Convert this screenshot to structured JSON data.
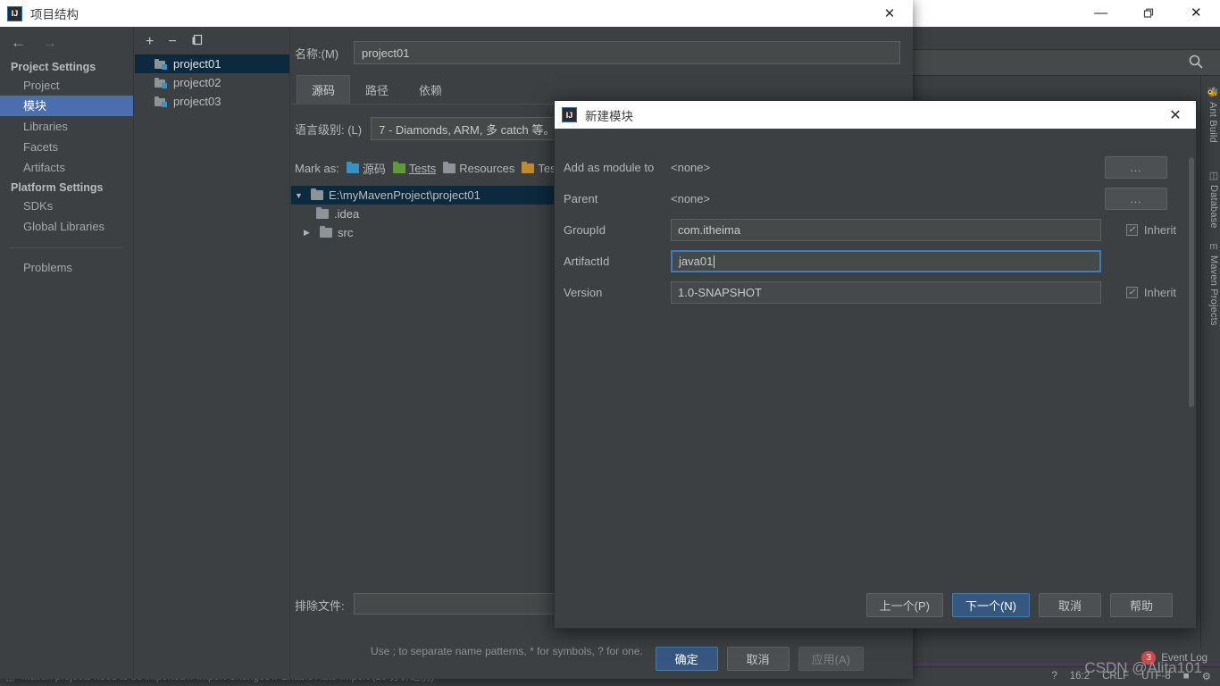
{
  "ide": {
    "window_controls": {
      "minimize": "—",
      "maximize": "❐",
      "close": "✕"
    },
    "search_icon": "search-icon",
    "right_toolwindows": [
      {
        "label": "Ant Build",
        "icon": "ant-icon"
      },
      {
        "label": "Database",
        "icon": "database-icon"
      },
      {
        "label": "Maven Projects",
        "icon": "maven-icon"
      }
    ],
    "statusbar": {
      "message": "Maven projects need to be imported // Import Changes // Enable Auto-Import (10 分钟之前)",
      "event_log": "Event Log",
      "event_count": "3",
      "caret": "16:2",
      "line_separator": "CRLF",
      "encoding": "UTF-8",
      "help": "?"
    },
    "watermark": "CSDN @Alita101"
  },
  "project_structure": {
    "title": "项目结构",
    "close_label": "✕",
    "nav": {
      "back": "←",
      "forward": "→",
      "groups": [
        {
          "label": "Project Settings",
          "items": [
            {
              "label": "Project",
              "selected": false
            },
            {
              "label": "模块",
              "selected": true
            },
            {
              "label": "Libraries",
              "selected": false
            },
            {
              "label": "Facets",
              "selected": false
            },
            {
              "label": "Artifacts",
              "selected": false
            }
          ]
        },
        {
          "label": "Platform Settings",
          "items": [
            {
              "label": "SDKs",
              "selected": false
            },
            {
              "label": "Global Libraries",
              "selected": false
            }
          ]
        }
      ],
      "extra": [
        {
          "label": "Problems"
        }
      ]
    },
    "modules_toolbar": {
      "add": "+",
      "remove": "−",
      "copy": "❐"
    },
    "modules": [
      {
        "label": "project01",
        "selected": true
      },
      {
        "label": "project02",
        "selected": false
      },
      {
        "label": "project03",
        "selected": false
      }
    ],
    "name_label": "名称:(M)",
    "name_value": "project01",
    "tabs": [
      {
        "label": "源码",
        "active": true
      },
      {
        "label": "路径",
        "active": false
      },
      {
        "label": "依赖",
        "active": false
      }
    ],
    "language_level_label": "语言级别: (L)",
    "language_level_value": "7 - Diamonds, ARM, 多 catch 等。",
    "mark_as_label": "Mark as:",
    "mark_as_items": [
      {
        "label": "源码",
        "color": "#3592c4"
      },
      {
        "label": "Tests",
        "color": "#5f9a3b"
      },
      {
        "label": "Resources",
        "color": "#8c9499"
      },
      {
        "label": "Test Resources",
        "color": "#c08a2f"
      }
    ],
    "tree": [
      {
        "label": "E:\\myMavenProject\\project01",
        "depth": 0,
        "expanded": true,
        "selected": true
      },
      {
        "label": ".idea",
        "depth": 1,
        "expanded": null,
        "selected": false
      },
      {
        "label": "src",
        "depth": 1,
        "expanded": false,
        "selected": false
      }
    ],
    "exclude_label": "排除文件:",
    "exclude_value": "",
    "exclude_hint": "Use ; to separate name patterns, * for symbols, ? for one.",
    "footer_buttons": [
      {
        "label": "确定",
        "style": "primary"
      },
      {
        "label": "取消",
        "style": "normal"
      },
      {
        "label": "应用(A)",
        "style": "disabled"
      }
    ]
  },
  "new_module": {
    "title": "新建模块",
    "close_label": "✕",
    "dots_label": "...",
    "inherit_label": "Inherit",
    "check_glyph": "✓",
    "fields": [
      {
        "name": "add_as_module_to",
        "label": "Add as module to",
        "type": "static",
        "value": "<none>",
        "button": "..."
      },
      {
        "name": "parent",
        "label": "Parent",
        "type": "static",
        "value": "<none>",
        "button": "..."
      },
      {
        "name": "groupid",
        "label": "GroupId",
        "type": "input",
        "value": "com.itheima",
        "focused": false,
        "inherit": true
      },
      {
        "name": "artifactid",
        "label": "ArtifactId",
        "type": "input",
        "value": "java01",
        "focused": true,
        "inherit": false
      },
      {
        "name": "version",
        "label": "Version",
        "type": "input",
        "value": "1.0-SNAPSHOT",
        "focused": false,
        "inherit": true
      }
    ],
    "footer_buttons": [
      {
        "label": "上一个(P)",
        "style": "normal"
      },
      {
        "label": "下一个(N)",
        "style": "primary"
      },
      {
        "label": "取消",
        "style": "normal"
      },
      {
        "label": "帮助",
        "style": "normal"
      }
    ]
  }
}
